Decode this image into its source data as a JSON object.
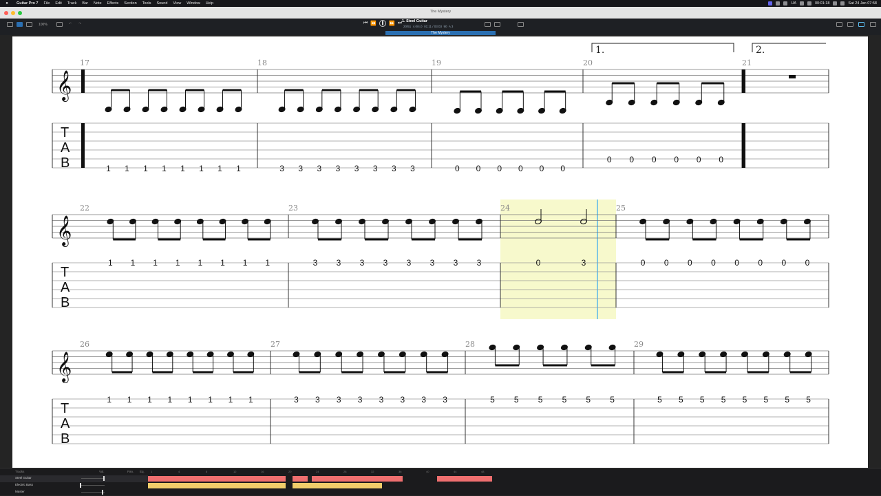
{
  "menubar": {
    "app_name": "Guitar Pro 7",
    "items": [
      "File",
      "Edit",
      "Track",
      "Bar",
      "Note",
      "Effects",
      "Section",
      "Tools",
      "Sound",
      "View",
      "Window",
      "Help"
    ],
    "clock_time": "00:01:18",
    "flag": "UA",
    "date": "Sat 24 Jan  07:58"
  },
  "window": {
    "title": "The Mystery",
    "zoom": "100%",
    "tab_title": "The Mystery"
  },
  "transport": {
    "track_name": "1. Steel Guitar",
    "bar_position": "20/51",
    "time_signature": "4.0/4.0",
    "time_position": "01:11 / 03:03",
    "tempo": "90",
    "tuning": "A 3"
  },
  "score": {
    "repeat_endings": [
      "1.",
      "2."
    ],
    "clef_label": "TAB",
    "rows": [
      {
        "measures": [
          {
            "number": "17",
            "tab": [
              "1",
              "1",
              "1",
              "1",
              "1",
              "1",
              "1",
              "1"
            ]
          },
          {
            "number": "18",
            "tab": [
              "3",
              "3",
              "3",
              "3",
              "3",
              "3",
              "3",
              "3"
            ]
          },
          {
            "number": "19",
            "tab": [
              "0",
              "0",
              "0",
              "0",
              "0",
              "0"
            ]
          },
          {
            "number": "20",
            "tab": [
              "0",
              "0",
              "0",
              "0",
              "0",
              "0"
            ]
          },
          {
            "number": "21",
            "tab": []
          }
        ]
      },
      {
        "measures": [
          {
            "number": "22",
            "tab": [
              "1",
              "1",
              "1",
              "1",
              "1",
              "1",
              "1",
              "1"
            ]
          },
          {
            "number": "23",
            "tab": [
              "3",
              "3",
              "3",
              "3",
              "3",
              "3",
              "3",
              "3"
            ]
          },
          {
            "number": "24",
            "tab": [
              "0",
              "3"
            ]
          },
          {
            "number": "25",
            "tab": [
              "0",
              "0",
              "0",
              "0",
              "0",
              "0",
              "0",
              "0"
            ]
          }
        ]
      },
      {
        "measures": [
          {
            "number": "26",
            "tab": [
              "1",
              "1",
              "1",
              "1",
              "1",
              "1",
              "1",
              "1"
            ]
          },
          {
            "number": "27",
            "tab": [
              "3",
              "3",
              "3",
              "3",
              "3",
              "3",
              "3",
              "3"
            ]
          },
          {
            "number": "28",
            "tab": [
              "5",
              "5",
              "5",
              "5",
              "5",
              "5"
            ]
          },
          {
            "number": "29",
            "tab": [
              "5",
              "5",
              "5",
              "5",
              "5",
              "5",
              "5",
              "5"
            ]
          }
        ]
      }
    ]
  },
  "tracks_panel": {
    "header": "Tracks",
    "vol_label": "Vol.",
    "pan_label": "Pan.",
    "eq_label": "Eq.",
    "tracks": [
      {
        "name": "Steel Guitar",
        "volume": 0.85
      },
      {
        "name": "Electric Bass",
        "volume": 0.05
      },
      {
        "name": "Master",
        "volume": 0.8
      }
    ],
    "ruler": [
      "1",
      "4",
      "8",
      "12",
      "16",
      "20",
      "24",
      "28",
      "32",
      "36",
      "40",
      "44",
      "48"
    ]
  },
  "colors": {
    "selection_highlight": "#f7f9cc",
    "playhead": "#5ab8e8",
    "guitar_track": "#ef6f6f",
    "bass_track": "#f1cd6a",
    "accent": "#2a6fb2"
  }
}
